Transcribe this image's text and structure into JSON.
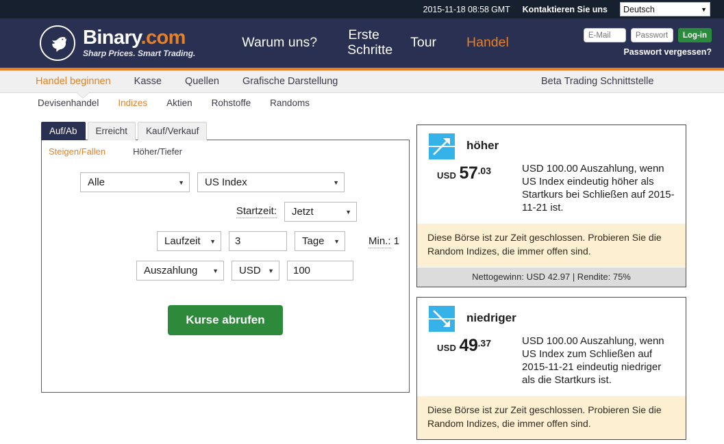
{
  "topbar": {
    "time": "2015-11-18 08:58 GMT",
    "contact": "Kontaktieren Sie uns",
    "language": "Deutsch"
  },
  "header": {
    "logo_main": "Binary",
    "logo_dotcom": ".com",
    "logo_tagline": "Sharp Prices. Smart Trading.",
    "nav": [
      {
        "label": "Warum uns?",
        "active": false
      },
      {
        "label": "Erste Schritte",
        "active": false
      },
      {
        "label": "Tour",
        "active": false
      },
      {
        "label": "Handel",
        "active": true
      }
    ],
    "email_placeholder": "E-Mail",
    "password_placeholder": "Passwort",
    "login_label": "Log-in",
    "forgot_label": "Passwort vergessen?"
  },
  "subnav1": {
    "items": [
      {
        "label": "Handel beginnen",
        "active": true
      },
      {
        "label": "Kasse",
        "active": false
      },
      {
        "label": "Quellen",
        "active": false
      },
      {
        "label": "Grafische Darstellung",
        "active": false
      }
    ],
    "right_label": "Beta Trading Schnittstelle"
  },
  "subnav2": {
    "items": [
      {
        "label": "Devisenhandel",
        "active": false
      },
      {
        "label": "Indizes",
        "active": true
      },
      {
        "label": "Aktien",
        "active": false
      },
      {
        "label": "Rohstoffe",
        "active": false
      },
      {
        "label": "Randoms",
        "active": false
      }
    ]
  },
  "form": {
    "tabs": [
      {
        "label": "Auf/Ab",
        "active": true
      },
      {
        "label": "Erreicht",
        "active": false
      },
      {
        "label": "Kauf/Verkauf",
        "active": false
      }
    ],
    "subtabs": [
      {
        "label": "Steigen/Fallen",
        "active": true
      },
      {
        "label": "Höher/Tiefer",
        "active": false
      }
    ],
    "asset_class": "Alle",
    "market": "US Index",
    "start_time_label": "Startzeit:",
    "start_time": "Jetzt",
    "duration_type": "Laufzeit",
    "duration_value": "3",
    "duration_unit": "Tage",
    "duration_min": "Min.: 1",
    "duration_min_prefix": "Min.:",
    "duration_min_value": "1",
    "basis": "Auszahlung",
    "currency": "USD",
    "amount": "100",
    "submit_label": "Kurse abrufen",
    "caret": "▼"
  },
  "cards": [
    {
      "direction": "up",
      "icon": "arrow-up-right-icon",
      "title": "höher",
      "price_currency": "USD",
      "price_integer": "57",
      "price_decimal": ".03",
      "description": "USD 100.00 Auszahlung, wenn US Index eindeutig höher als Startkurs bei Schließen auf 2015-11-21 ist.",
      "warning": "Diese Börse ist zur Zeit geschlossen. Probieren Sie die Random Indizes, die immer offen sind.",
      "footer": "Nettogewinn: USD 42.97 | Rendite: 75%",
      "has_footer": true
    },
    {
      "direction": "down",
      "icon": "arrow-down-right-icon",
      "title": "niedriger",
      "price_currency": "USD",
      "price_integer": "49",
      "price_decimal": ".37",
      "description": "USD 100.00 Auszahlung, wenn US Index zum Schließen auf 2015-11-21 eindeutig niedriger als die Startkurs ist.",
      "warning": "Diese Börse ist zur Zeit geschlossen. Probieren Sie die Random Indizes, die immer offen sind.",
      "footer": "",
      "has_footer": false
    }
  ],
  "colors": {
    "navy": "#2a3052",
    "dark": "#17202e",
    "orange": "#e98024",
    "green": "#2d8a3b",
    "icon_blue": "#35b3e8",
    "warn_bg": "#fdf0d2"
  }
}
